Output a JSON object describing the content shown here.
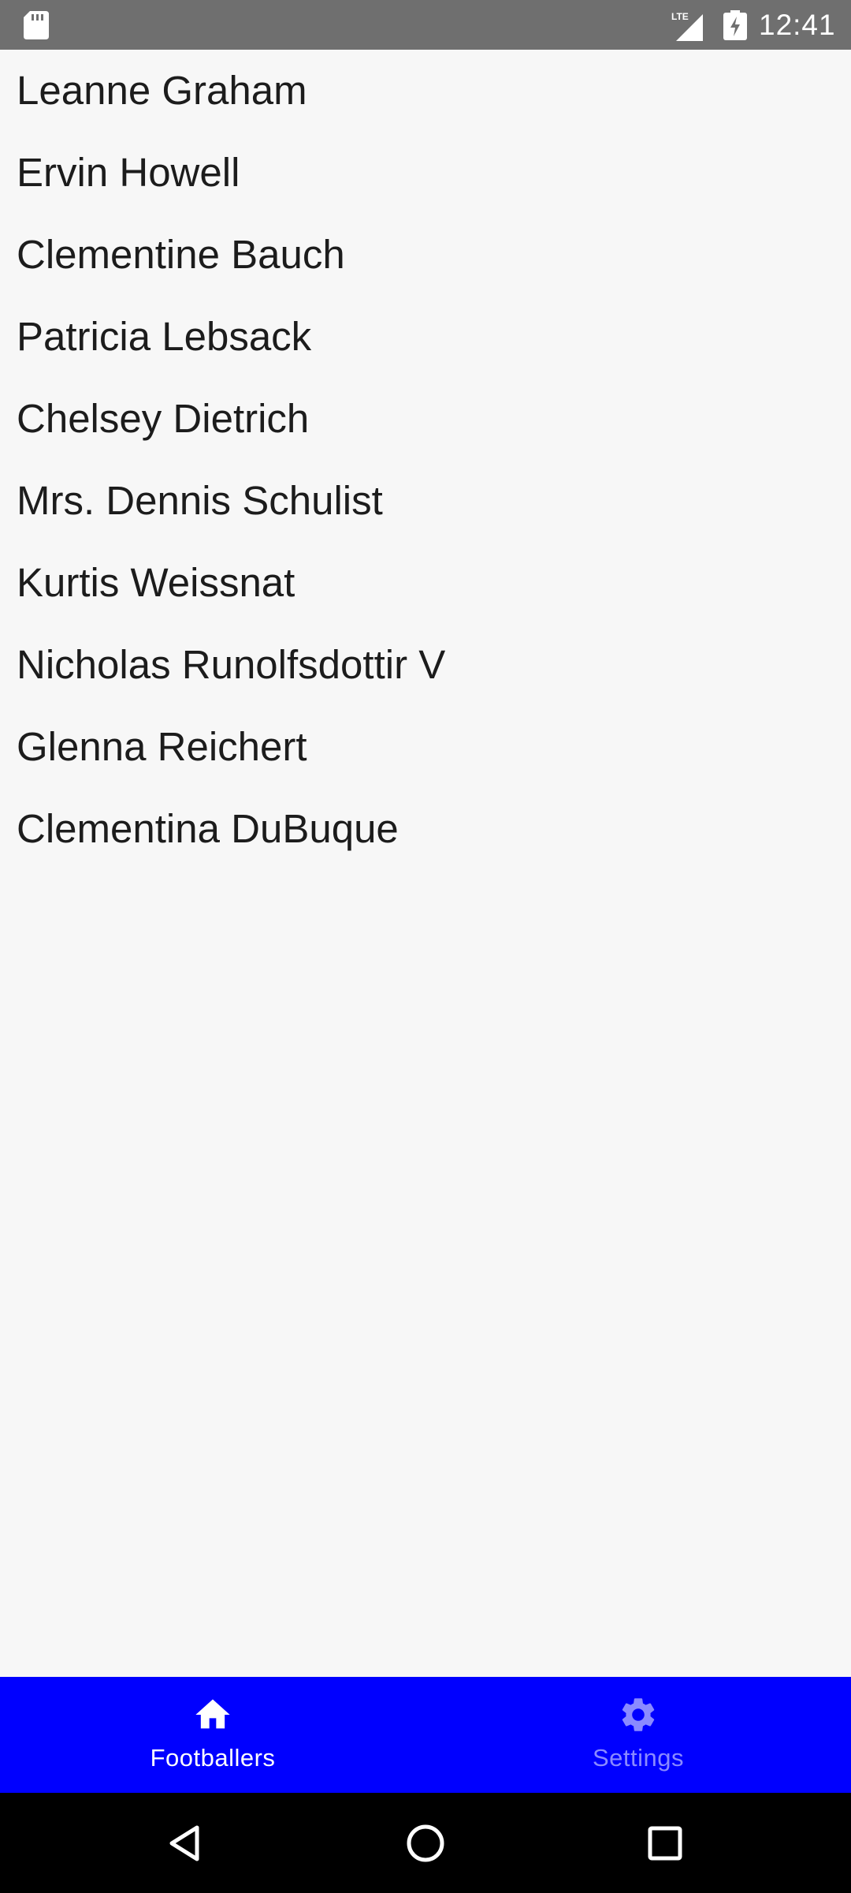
{
  "status_bar": {
    "time": "12:41",
    "network_label": "LTE",
    "icons": [
      "sd-card-icon",
      "lte-signal-icon",
      "battery-charging-icon"
    ]
  },
  "footballers": [
    "Leanne Graham",
    "Ervin Howell",
    "Clementine Bauch",
    "Patricia Lebsack",
    "Chelsey Dietrich",
    "Mrs. Dennis Schulist",
    "Kurtis Weissnat",
    "Nicholas Runolfsdottir V",
    "Glenna Reichert",
    "Clementina DuBuque"
  ],
  "bottom_nav": {
    "tabs": [
      {
        "label": "Footballers",
        "icon": "home-icon",
        "active": true
      },
      {
        "label": "Settings",
        "icon": "gear-icon",
        "active": false
      }
    ]
  },
  "system_nav": {
    "buttons": [
      "back-icon",
      "home-circle-icon",
      "recent-apps-icon"
    ]
  },
  "colors": {
    "status_bar": "#6f6f6f",
    "background": "#f7f7f7",
    "bottom_nav": "#0000ff",
    "active_tab": "#ffffff",
    "inactive_tab": "#8a8aff",
    "system_nav": "#000000",
    "list_text": "#1c1c1c"
  }
}
